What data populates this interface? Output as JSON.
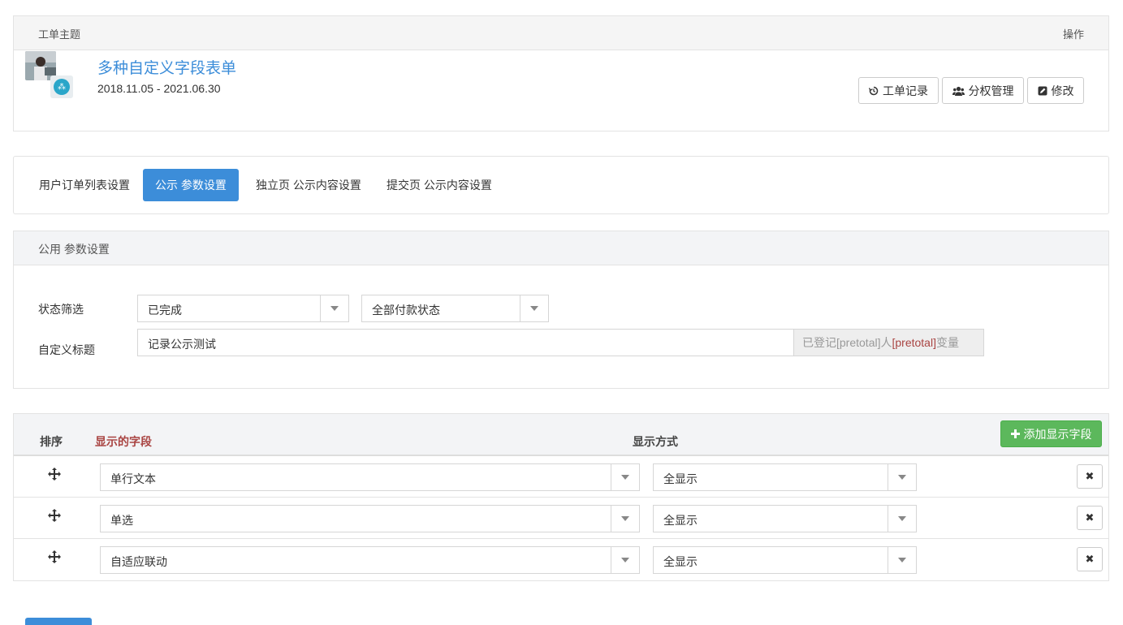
{
  "ticket": {
    "col_topic": "工单主题",
    "col_action": "操作",
    "title": "多种自定义字段表单",
    "dates": "2018.11.05 - 2021.06.30",
    "btn_records": "工单记录",
    "btn_permissions": "分权管理",
    "btn_edit": "修改"
  },
  "tabs": [
    {
      "label": "用户订单列表设置",
      "active": false
    },
    {
      "label": "公示 参数设置",
      "active": true
    },
    {
      "label": "独立页 公示内容设置",
      "active": false
    },
    {
      "label": "提交页 公示内容设置",
      "active": false
    }
  ],
  "params": {
    "header": "公用 参数设置",
    "status_label": "状态筛选",
    "status_value": "已完成",
    "payment_value": "全部付款状态",
    "custom_title_label": "自定义标题",
    "custom_title_value": "记录公示测试",
    "addon_prefix": "已登记[pretotal]人 ",
    "addon_var": "[pretotal]",
    "addon_suffix": "变量"
  },
  "fields_table": {
    "col_order": "排序",
    "col_field": "显示的字段",
    "col_mode": "显示方式",
    "add_button": "添加显示字段",
    "rows": [
      {
        "field": "单行文本",
        "mode": "全显示"
      },
      {
        "field": "单选",
        "mode": "全显示"
      },
      {
        "field": "自适应联动",
        "mode": "全显示"
      }
    ]
  },
  "colors": {
    "primary": "#3c8dd9",
    "success": "#5cb85c",
    "danger_text": "#a94442"
  }
}
